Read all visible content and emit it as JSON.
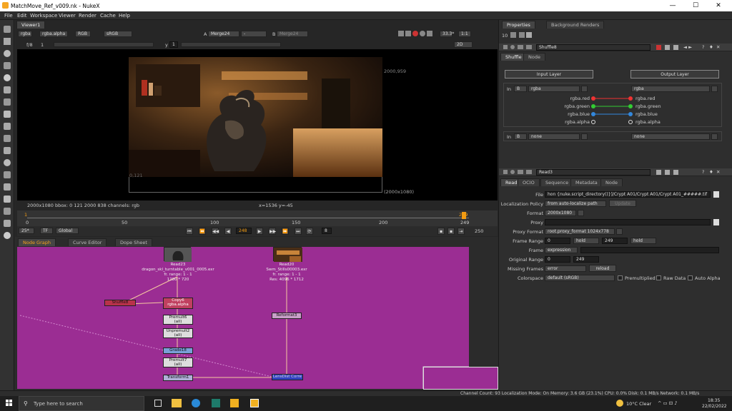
{
  "window": {
    "title": "MatchMove_Ref_v009.nk - NukeX",
    "minimize": "—",
    "maximize": "☐",
    "close": "✕"
  },
  "menu": [
    "File",
    "Edit",
    "Workspace",
    "Viewer",
    "Render",
    "Cache",
    "Help"
  ],
  "viewer": {
    "tab": "Viewer1",
    "channels": "rgba",
    "alpha": "rgba.alpha",
    "rgb": "RGB",
    "colorspace": "sRGB",
    "a_label": "A",
    "a_input": "Merge24",
    "a_op": "-",
    "b_label": "B",
    "b_input": "Merge24",
    "zoom": "33.3*",
    "ratio": "1:1",
    "fstop": "f/8",
    "frame_small": "1",
    "y_label": "y",
    "y_value": "1",
    "view_mode": "2D",
    "top_right_label": "2000,959",
    "bottom_right_label": "(2000x1080)",
    "bottom_left_label": "0,121",
    "info_left": "2000x1080  bbox: 0 121 2000 838 channels: rgb",
    "info_mid": "x=1536 y=-45",
    "ruler_ticks": [
      "0",
      "50",
      "100",
      "150",
      "200",
      "249"
    ],
    "fps": "25*",
    "tf": "TF",
    "global": "Global",
    "current_frame": "248",
    "increment": "8",
    "end_frame": "250",
    "start_marker": "1",
    "end_marker": "249"
  },
  "graph": {
    "tabs": [
      "Node Graph",
      "Curve Editor",
      "Dope Sheet"
    ],
    "nodes": [
      {
        "name": "read23",
        "title": "Read23",
        "sub1": "dragon_skl_turntable_v001_0005.exr",
        "sub2": "fr. range: 1 - 1",
        "sub3": "1280 * 720"
      },
      {
        "name": "read20",
        "title": "Read20",
        "sub1": "Swm_Stills00003.exr",
        "sub2": "fr. range: 1 - 1",
        "sub3": "Res: 4096 * 1712"
      },
      {
        "name": "shuffle",
        "title": "Shuffle8"
      },
      {
        "name": "copy",
        "title": "Copy6",
        "sub1": "rgba.alpha"
      },
      {
        "name": "premult6",
        "title": "Premult6",
        "sub1": "(all)"
      },
      {
        "name": "unpremult",
        "title": "Unpremult2",
        "sub1": "(all)"
      },
      {
        "name": "grade",
        "title": "Grade18"
      },
      {
        "name": "premult7",
        "title": "Premult7",
        "sub1": "(all)"
      },
      {
        "name": "transform",
        "title": "Transform1"
      },
      {
        "name": "reformat",
        "title": "Reformat3"
      },
      {
        "name": "lensdist",
        "title": "LensDist Corre"
      }
    ]
  },
  "props": {
    "tabs": [
      "Properties",
      "Background Renders"
    ],
    "count": "10",
    "shuffle": {
      "title": "Shuffle8",
      "tabs": [
        "Shuffle",
        "Node"
      ],
      "input_layer": "Input Layer",
      "output_layer": "Output Layer",
      "in_label": "In",
      "b_label": "B",
      "in_layer": "rgba",
      "out_layer": "rgba",
      "in_channels": [
        "rgba.red",
        "rgba.green",
        "rgba.blue",
        "rgba.alpha"
      ],
      "out_channels": [
        "rgba.red",
        "rgba.green",
        "rgba.blue",
        "rgba.alpha"
      ],
      "in2_label": "In",
      "in2_layer": "none",
      "out2_layer": "none"
    },
    "read": {
      "title": "Read3",
      "tabs": [
        "Read",
        "OCIO",
        "Sequence",
        "Metadata",
        "Node"
      ],
      "file_label": "File",
      "file_value": "hon {nuke.script_directory()}]/Crypt A01/Crypt A01/Crypt A01_#####.tif",
      "localization_label": "Localization Policy",
      "localization_value": "from auto-localize path",
      "update": "Update",
      "format_label": "Format",
      "format_value": "2000x1080",
      "proxy_label": "Proxy",
      "proxy_format_label": "Proxy Format",
      "proxy_format_value": "root.proxy_format 1024x778",
      "frame_range_label": "Frame Range",
      "frame_start": "0",
      "hold1": "hold",
      "frame_end": "249",
      "hold2": "hold",
      "frame_label": "Frame",
      "frame_value": "expression",
      "original_range_label": "Original Range",
      "orig_start": "0",
      "orig_end": "249",
      "missing_label": "Missing Frames",
      "missing_value": "error",
      "reload": "reload",
      "colorspace_label": "Colorspace",
      "colorspace_value": "default (sRGB)",
      "premultiplied": "Premultiplied",
      "raw_data": "Raw Data",
      "auto_alpha": "Auto Alpha"
    }
  },
  "status": "Channel Count: 93  Localization Mode: On  Memory: 3.6 GB (23.1%)  CPU: 0.0%  Disk: 0.1 MB/s  Network: 0.1 MB/s",
  "taskbar": {
    "search": "Type here to search",
    "weather": "10°C  Clear",
    "time": "18:35",
    "date": "22/02/2022"
  }
}
